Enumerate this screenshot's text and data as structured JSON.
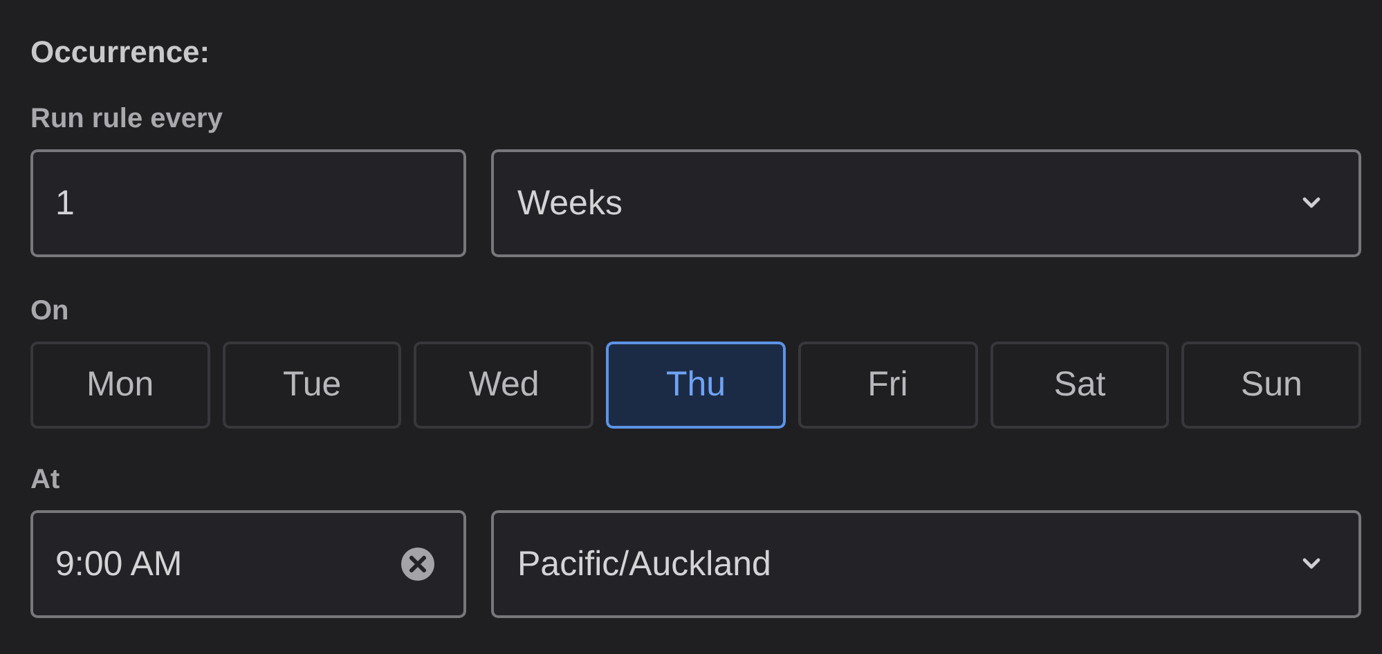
{
  "section_title": "Occurrence:",
  "interval": {
    "label": "Run rule every",
    "value": "1",
    "unit": "Weeks"
  },
  "days": {
    "label": "On",
    "items": [
      {
        "label": "Mon",
        "selected": false
      },
      {
        "label": "Tue",
        "selected": false
      },
      {
        "label": "Wed",
        "selected": false
      },
      {
        "label": "Thu",
        "selected": true
      },
      {
        "label": "Fri",
        "selected": false
      },
      {
        "label": "Sat",
        "selected": false
      },
      {
        "label": "Sun",
        "selected": false
      }
    ]
  },
  "time": {
    "label": "At",
    "value": "9:00 AM",
    "timezone": "Pacific/Auckland"
  }
}
